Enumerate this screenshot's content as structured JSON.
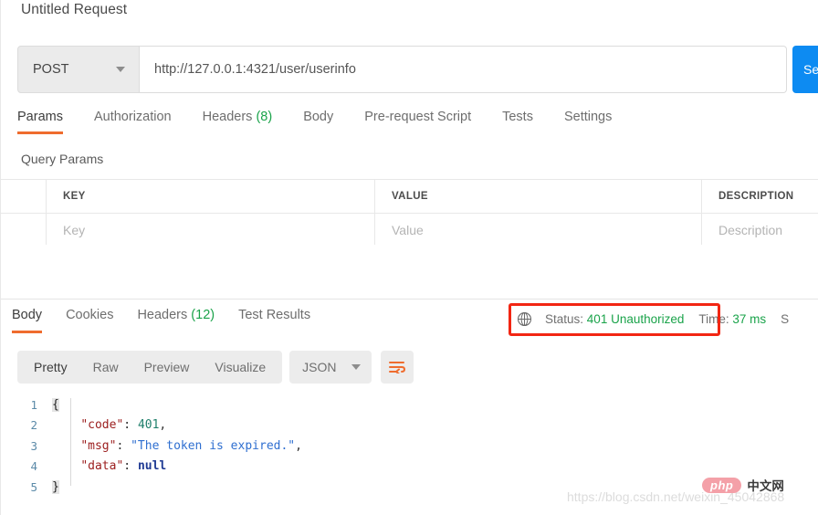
{
  "request": {
    "title": "Untitled Request",
    "method": "POST",
    "method_caret_icon": "chevron-down-icon",
    "url": "http://127.0.0.1:4321/user/userinfo",
    "send_label": "Send",
    "tabs": [
      {
        "label": "Params",
        "count": "",
        "active": true
      },
      {
        "label": "Authorization",
        "count": "",
        "active": false
      },
      {
        "label": "Headers",
        "count": "(8)",
        "active": false
      },
      {
        "label": "Body",
        "count": "",
        "active": false
      },
      {
        "label": "Pre-request Script",
        "count": "",
        "active": false
      },
      {
        "label": "Tests",
        "count": "",
        "active": false
      },
      {
        "label": "Settings",
        "count": "",
        "active": false
      }
    ],
    "query_params_label": "Query Params",
    "table": {
      "columns": [
        "KEY",
        "VALUE",
        "DESCRIPTION"
      ],
      "placeholder_row": [
        "Key",
        "Value",
        "Description"
      ]
    }
  },
  "response": {
    "tabs": [
      {
        "label": "Body",
        "count": "",
        "active": true
      },
      {
        "label": "Cookies",
        "count": "",
        "active": false
      },
      {
        "label": "Headers",
        "count": "(12)",
        "active": false
      },
      {
        "label": "Test Results",
        "count": "",
        "active": false
      }
    ],
    "globe_icon": "globe-icon",
    "status_label": "Status:",
    "status_value": "401 Unauthorized",
    "time_label": "Time:",
    "time_value": "37 ms",
    "size_label": "S",
    "highlight_color": "#f22613",
    "status_color": "#1aa34a",
    "toolbar": {
      "views": [
        {
          "label": "Pretty",
          "active": true
        },
        {
          "label": "Raw",
          "active": false
        },
        {
          "label": "Preview",
          "active": false
        },
        {
          "label": "Visualize",
          "active": false
        }
      ],
      "format": "JSON",
      "format_caret_icon": "chevron-down-icon",
      "wrap_icon": "wrap-text-icon"
    },
    "body_lines": [
      {
        "n": "1",
        "tokens": [
          {
            "t": "brace",
            "v": "{"
          }
        ]
      },
      {
        "n": "2",
        "tokens": [
          {
            "t": "plain",
            "v": "    "
          },
          {
            "t": "key",
            "v": "\"code\""
          },
          {
            "t": "punc",
            "v": ": "
          },
          {
            "t": "num",
            "v": "401"
          },
          {
            "t": "punc",
            "v": ","
          }
        ]
      },
      {
        "n": "3",
        "tokens": [
          {
            "t": "plain",
            "v": "    "
          },
          {
            "t": "key",
            "v": "\"msg\""
          },
          {
            "t": "punc",
            "v": ": "
          },
          {
            "t": "str",
            "v": "\"The token is expired.\""
          },
          {
            "t": "punc",
            "v": ","
          }
        ]
      },
      {
        "n": "4",
        "tokens": [
          {
            "t": "plain",
            "v": "    "
          },
          {
            "t": "key",
            "v": "\"data\""
          },
          {
            "t": "punc",
            "v": ": "
          },
          {
            "t": "null",
            "v": "null"
          }
        ]
      },
      {
        "n": "5",
        "tokens": [
          {
            "t": "brace",
            "v": "}"
          }
        ]
      }
    ]
  },
  "watermark": {
    "url": "https://blog.csdn.net/weixin_45042868",
    "logo_php": "php",
    "logo_cn": "中文网"
  }
}
